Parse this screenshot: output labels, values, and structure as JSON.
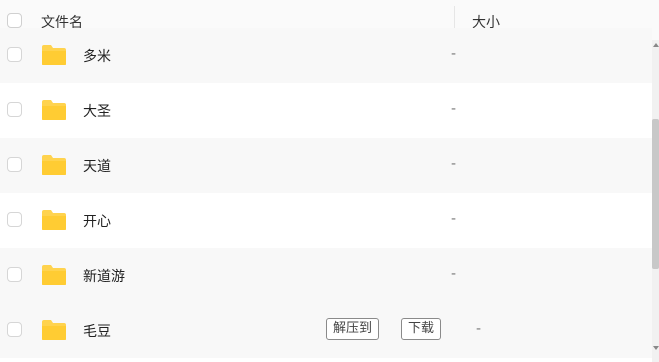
{
  "header": {
    "name_label": "文件名",
    "size_label": "大小"
  },
  "files": [
    {
      "name": "多米",
      "size": "-",
      "icon": "folder-icon",
      "icon_color": "#ffd34e"
    },
    {
      "name": "大圣",
      "size": "-",
      "icon": "folder-icon",
      "icon_color": "#ffd34e"
    },
    {
      "name": "天道",
      "size": "-",
      "icon": "folder-icon",
      "icon_color": "#ffd34e"
    },
    {
      "name": "开心",
      "size": "-",
      "icon": "folder-icon",
      "icon_color": "#ffd34e"
    },
    {
      "name": "新道游",
      "size": "-",
      "icon": "folder-icon",
      "icon_color": "#ffd34e"
    },
    {
      "name": "毛豆",
      "size": "-",
      "icon": "folder-icon",
      "icon_color": "#ffd34e"
    }
  ],
  "row_actions": {
    "extract_label": "解压到",
    "download_label": "下载"
  },
  "colors": {
    "folder": "#ffd34e",
    "alt_row": "#f8f8f8",
    "header_bg": "#fafafa"
  }
}
